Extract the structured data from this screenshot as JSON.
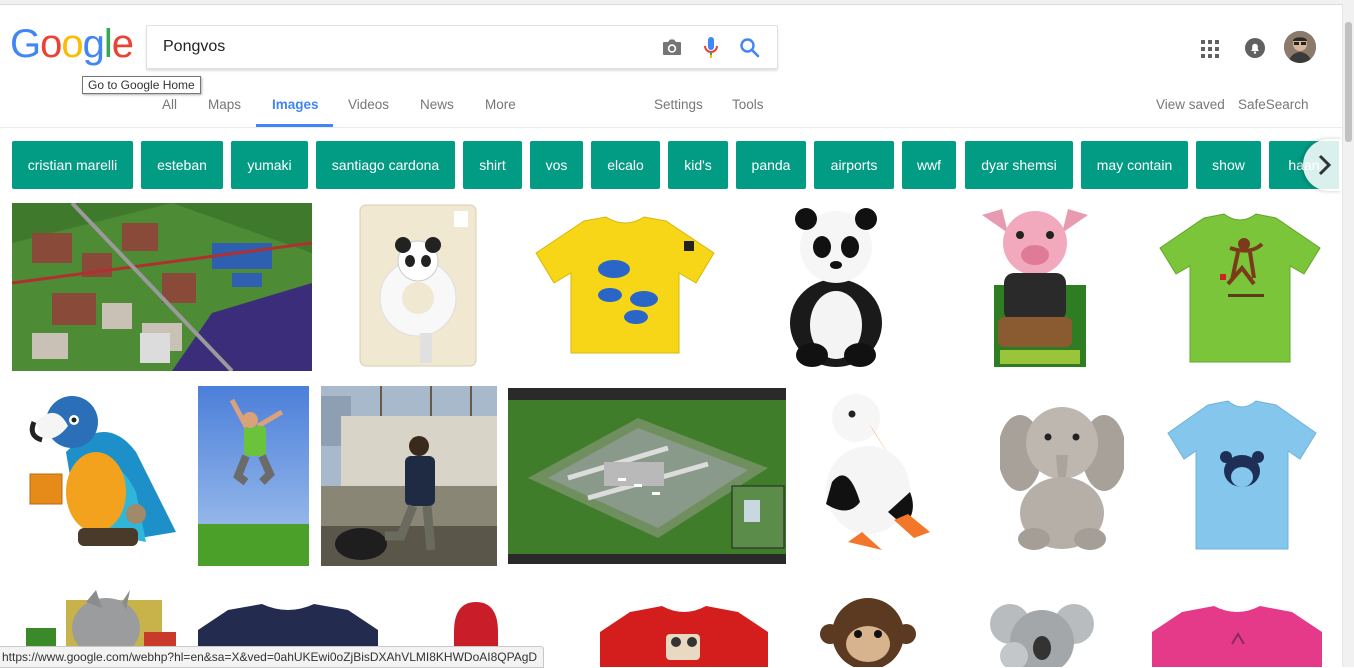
{
  "logo": {
    "letters": [
      "G",
      "o",
      "o",
      "g",
      "l",
      "e"
    ],
    "colors": [
      "#4285f4",
      "#ea4335",
      "#fbbc05",
      "#4285f4",
      "#34a853",
      "#ea4335"
    ],
    "tooltip": "Go to Google Home"
  },
  "search": {
    "value": "Pongvos"
  },
  "icons": {
    "camera": "camera-icon",
    "mic": "mic-icon",
    "search": "search-icon",
    "apps": "apps-grid-icon",
    "notifications": "bell-icon"
  },
  "tabs": [
    {
      "label": "All"
    },
    {
      "label": "Maps"
    },
    {
      "label": "Images"
    },
    {
      "label": "Videos"
    },
    {
      "label": "News"
    },
    {
      "label": "More"
    },
    {
      "label": "Settings"
    },
    {
      "label": "Tools"
    }
  ],
  "right_links": {
    "view_saved": "View saved",
    "safesearch": "SafeSearch"
  },
  "chips": [
    "cristian marelli",
    "esteban",
    "yumaki",
    "santiago cardona",
    "shirt",
    "vos",
    "elcalo",
    "kid's",
    "panda",
    "airports",
    "wwf",
    "dyar shemsi",
    "may contain",
    "show",
    "haan"
  ],
  "accent": {
    "chip": "#029b84",
    "tab_active": "#4285f4"
  },
  "status_url": "https://www.google.com/webhp?hl=en&sa=X&ved=0ahUKEwi0oZjBisDXAhVLMI8KHWDoAI8QPAgD"
}
